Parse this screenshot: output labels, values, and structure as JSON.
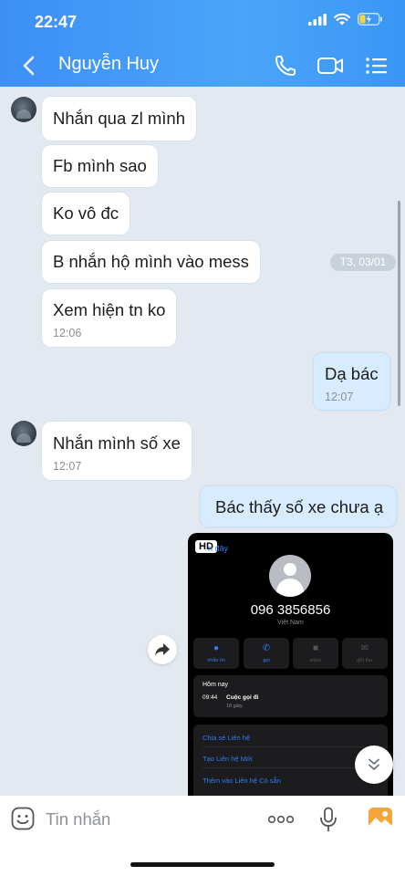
{
  "status_bar": {
    "time": "22:47"
  },
  "header": {
    "contact_name": "Nguyễn Huy"
  },
  "messages": [
    {
      "text": "Nhắn qua zl mình"
    },
    {
      "text": "Fb mình sao"
    },
    {
      "text": "Ko vô đc"
    },
    {
      "text": "B nhắn hộ mình vào mess"
    },
    {
      "text": "Xem hiện tn ko",
      "time": "12:06"
    },
    {
      "text": "Dạ bác",
      "time": "12:07"
    },
    {
      "text": "Nhắn mình số xe",
      "time": "12:07"
    },
    {
      "text": "Bác thấy số xe chưa ạ"
    }
  ],
  "date_divider": "T3, 03/01",
  "image_message": {
    "badge": "HD",
    "back_link": "n đây",
    "phone_number": "096 3856856",
    "country": "Việt Nam",
    "actions": [
      "nhắn tin",
      "gọi",
      "video",
      "gửi thư"
    ],
    "recents": {
      "title": "Hôm nay",
      "time": "09:44",
      "type": "Cuộc gọi đi",
      "duration": "18 giây"
    },
    "options": [
      "Chia sẻ Liên hệ",
      "Tạo Liên hệ Mới",
      "Thêm vào Liên hệ Có sẵn"
    ]
  },
  "input": {
    "placeholder": "Tin nhắn"
  },
  "colors": {
    "header": "#3d8ff5",
    "chat_bg": "#e2e9f1",
    "outgoing_bubble": "#d7ecff",
    "link_blue": "#2f7df6"
  }
}
